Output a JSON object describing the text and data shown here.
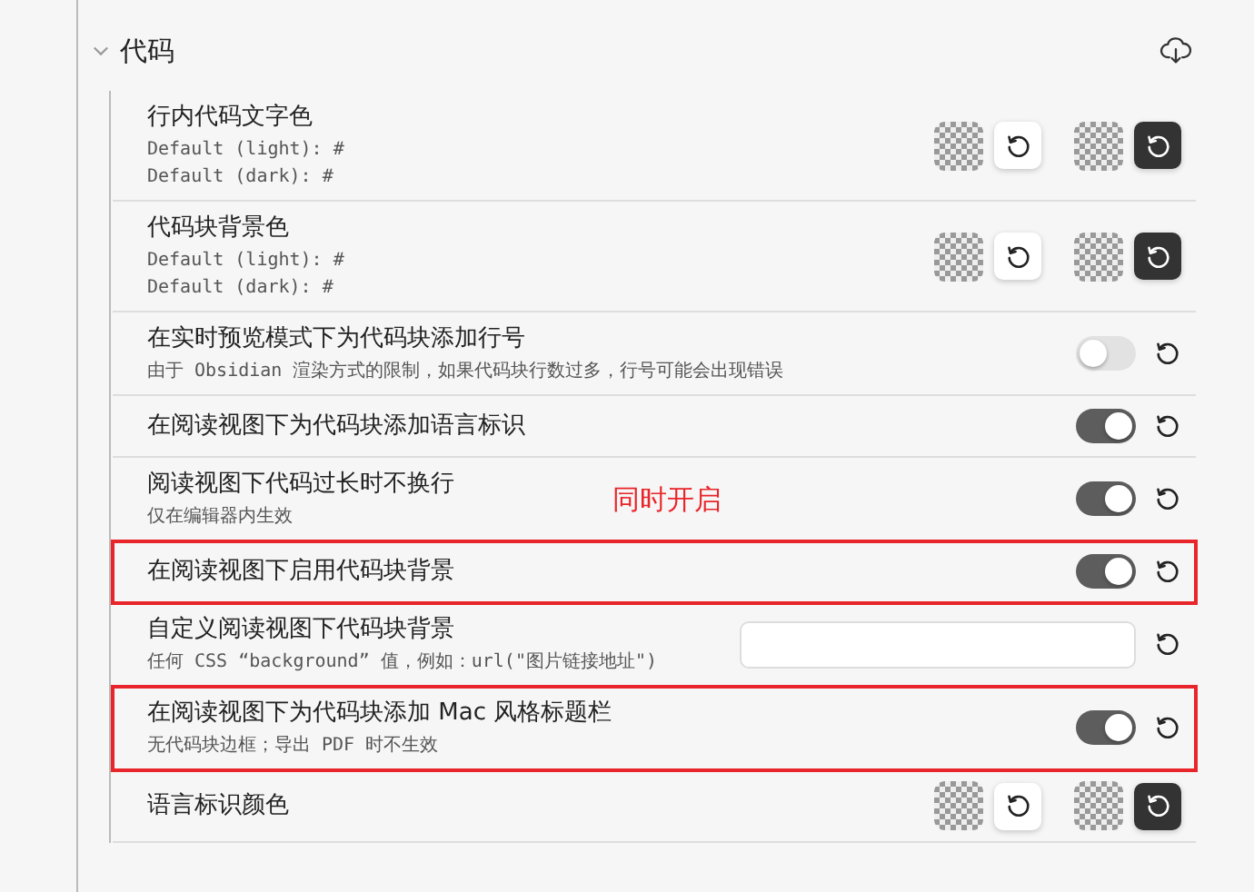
{
  "section": {
    "title": "代码",
    "expanded": true
  },
  "rows": [
    {
      "kind": "color",
      "title": "行内代码文字色",
      "description": [
        "Default (light): #",
        "Default (dark): #"
      ]
    },
    {
      "kind": "color",
      "title": "代码块背景色",
      "description": [
        "Default (light): #",
        "Default (dark): #"
      ]
    },
    {
      "kind": "toggle",
      "title": "在实时预览模式下为代码块添加行号",
      "description": [
        "由于 Obsidian 渲染方式的限制，如果代码块行数过多，行号可能会出现错误"
      ],
      "on": false
    },
    {
      "kind": "toggle",
      "title": "在阅读视图下为代码块添加语言标识",
      "description": [],
      "on": true
    },
    {
      "kind": "toggle",
      "title": "阅读视图下代码过长时不换行",
      "description": [
        "仅在编辑器内生效"
      ],
      "on": true,
      "annotation": "同时开启"
    },
    {
      "kind": "toggle",
      "title": "在阅读视图下启用代码块背景",
      "description": [],
      "on": true,
      "highlighted": true
    },
    {
      "kind": "text",
      "title": "自定义阅读视图下代码块背景",
      "description": [
        "任何 CSS “background” 值，例如：url(\"图片链接地址\")"
      ]
    },
    {
      "kind": "toggle",
      "title": "在阅读视图下为代码块添加 Mac 风格标题栏",
      "description": [
        "无代码块边框；导出 PDF 时不生效"
      ],
      "on": true,
      "highlighted": true
    },
    {
      "kind": "color",
      "title": "语言标识颜色",
      "description": []
    }
  ]
}
